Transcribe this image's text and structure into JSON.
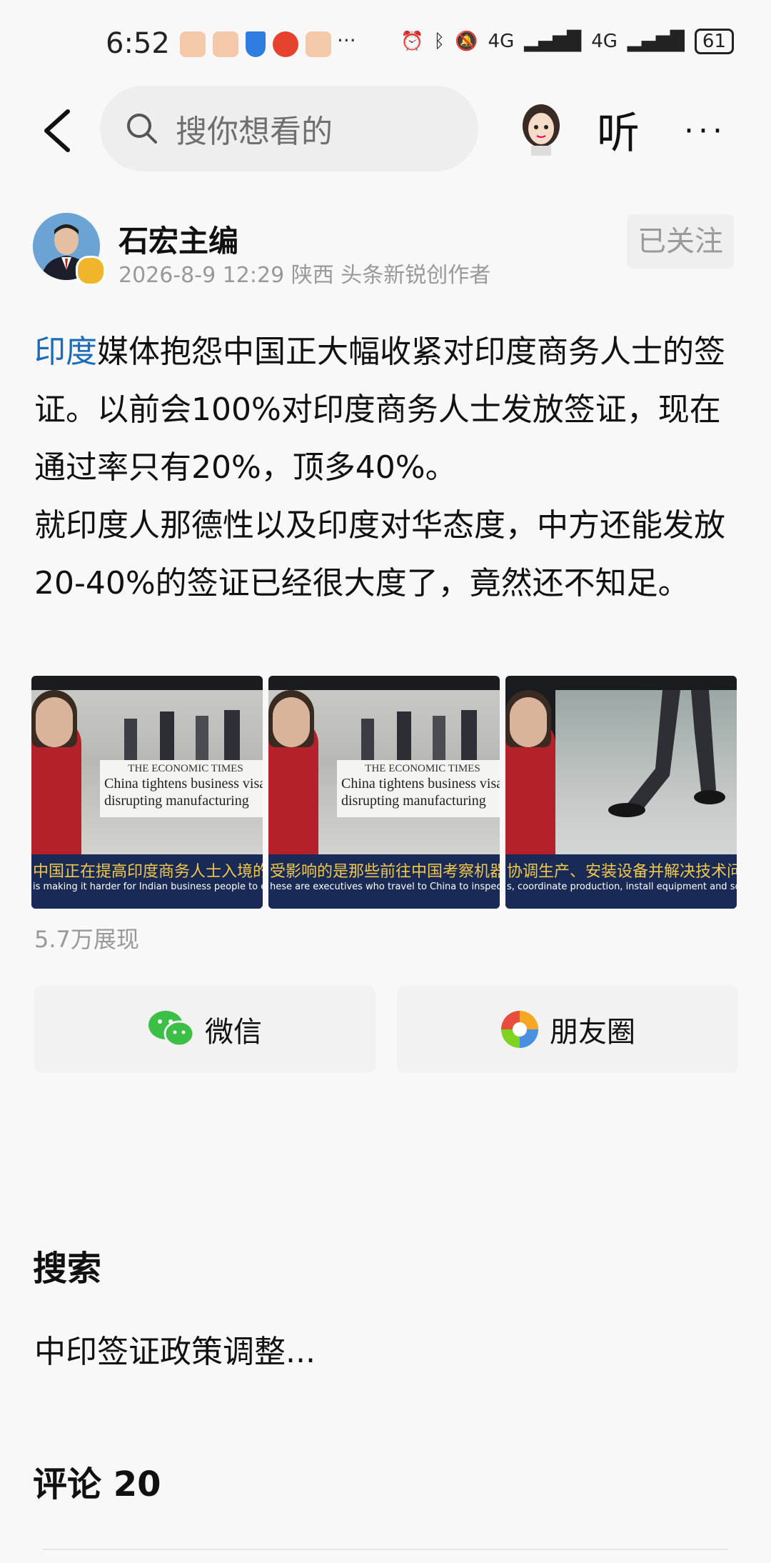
{
  "status_bar": {
    "time": "6:52",
    "more": "···",
    "net1": "4G",
    "net2": "4G",
    "battery": "61"
  },
  "top_bar": {
    "search_placeholder": "搜你想看的",
    "listen_label": "听",
    "more_label": "···"
  },
  "author": {
    "name": "石宏主编",
    "meta": "2026-8-9 12:29 陕西 头条新锐创作者",
    "follow_label": "已关注"
  },
  "article": {
    "link_word": "印度",
    "text_rest": "媒体抱怨中国正大幅收紧对印度商务人士的签证。以前会100%对印度商务人士发放签证，现在通过率只有20%，顶多40%。",
    "text_para2": "就印度人那德性以及印度对华态度，中方还能发放20-40%的签证已经很大度了，竟然还不知足。"
  },
  "thumbnails": [
    {
      "paper": "THE ECONOMIC TIMES",
      "headline1": "China tightens business visa",
      "headline2": "disrupting manufacturing",
      "sub_zh": "中国正在提高印度商务人士入境的门槛",
      "sub_en": "is making it harder for Indian business people to enter the c"
    },
    {
      "paper": "THE ECONOMIC TIMES",
      "headline1": "China tightens business visa",
      "headline2": "disrupting manufacturing",
      "sub_zh": "受影响的是那些前往中国考察机器、",
      "sub_en": "hese are executives who travel to China to inspect machiner"
    },
    {
      "sub_zh": "协调生产、安装设备并解决技术问题",
      "sub_en": "s, coordinate production, install equipment and solve techn"
    }
  ],
  "views": "5.7万展现",
  "share": {
    "wechat": "微信",
    "moments": "朋友圈"
  },
  "search_section": {
    "title": "搜索",
    "suggestion": "中印签证政策调整..."
  },
  "comments": {
    "title": "评论 20"
  },
  "colors": {
    "link": "#1b6bb8",
    "wechat_green": "#3bbf45",
    "subtitle_band": "#182a55",
    "subtitle_text": "#f2c84b"
  },
  "icons": [
    "back-arrow-icon",
    "search-icon",
    "ai-avatar-icon",
    "wechat-icon",
    "moments-icon",
    "verified-badge-icon"
  ]
}
